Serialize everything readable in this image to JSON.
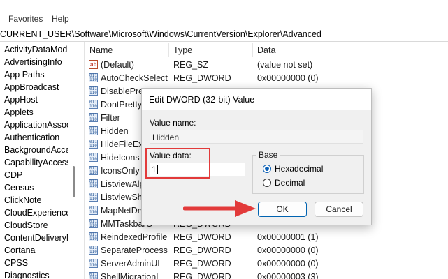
{
  "menu": {
    "favorites": "Favorites",
    "help": "Help"
  },
  "address": "CURRENT_USER\\Software\\Microsoft\\Windows\\CurrentVersion\\Explorer\\Advanced",
  "tree": [
    "ActivityDataMod",
    "AdvertisingInfo",
    "App Paths",
    "AppBroadcast",
    "AppHost",
    "Applets",
    "ApplicationAssoc",
    "Authentication",
    "BackgroundAcce",
    "CapabilityAccess",
    "CDP",
    "Census",
    "ClickNote",
    "CloudExperience",
    "CloudStore",
    "ContentDeliveryM",
    "Cortana",
    "CPSS",
    "Diagnostics"
  ],
  "list": {
    "headers": {
      "name": "Name",
      "type": "Type",
      "data": "Data"
    },
    "rows": [
      {
        "icon": "string",
        "name": "(Default)",
        "type": "REG_SZ",
        "data": "(value not set)"
      },
      {
        "icon": "binary",
        "name": "AutoCheckSelect",
        "type": "REG_DWORD",
        "data": "0x00000000 (0)"
      },
      {
        "icon": "binary",
        "name": "DisablePrev",
        "type": "",
        "data": ""
      },
      {
        "icon": "binary",
        "name": "DontPrettyI",
        "type": "",
        "data": ""
      },
      {
        "icon": "binary",
        "name": "Filter",
        "type": "",
        "data": ""
      },
      {
        "icon": "binary",
        "name": "Hidden",
        "type": "",
        "data": ""
      },
      {
        "icon": "binary",
        "name": "HideFileExt",
        "type": "",
        "data": ""
      },
      {
        "icon": "binary",
        "name": "HideIcons",
        "type": "",
        "data": ""
      },
      {
        "icon": "binary",
        "name": "IconsOnly",
        "type": "",
        "data": ""
      },
      {
        "icon": "binary",
        "name": "ListviewAlp",
        "type": "",
        "data": ""
      },
      {
        "icon": "binary",
        "name": "ListviewSha",
        "type": "",
        "data": ""
      },
      {
        "icon": "binary",
        "name": "MapNetDrv",
        "type": "",
        "data": ""
      },
      {
        "icon": "binary",
        "name": "MMTaskbarG",
        "type": "REG_DWORD",
        "data": ""
      },
      {
        "icon": "binary",
        "name": "ReindexedProfile",
        "type": "REG_DWORD",
        "data": "0x00000001 (1)"
      },
      {
        "icon": "binary",
        "name": "SeparateProcess",
        "type": "REG_DWORD",
        "data": "0x00000000 (0)"
      },
      {
        "icon": "binary",
        "name": "ServerAdminUI",
        "type": "REG_DWORD",
        "data": "0x00000000 (0)"
      },
      {
        "icon": "binary",
        "name": "ShellMigrationL",
        "type": "REG_DWORD",
        "data": "0x00000003 (3)"
      }
    ]
  },
  "dialog": {
    "title": "Edit DWORD (32-bit) Value",
    "value_name_label": "Value name:",
    "value_name": "Hidden",
    "value_data_label": "Value data:",
    "value_data": "1",
    "base_label": "Base",
    "hex_label": "Hexadecimal",
    "dec_label": "Decimal",
    "base_selected": "Hexadecimal",
    "ok": "OK",
    "cancel": "Cancel"
  },
  "colors": {
    "annotation": "#e23a3a",
    "accent": "#0a5fb5"
  }
}
